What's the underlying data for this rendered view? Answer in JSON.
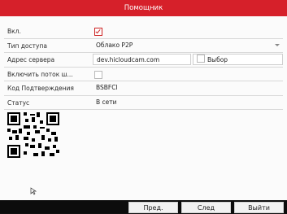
{
  "window": {
    "title": "Помощник"
  },
  "form": {
    "enable_label": "Вкл.",
    "enable_checked": true,
    "access_type_label": "Тип доступа",
    "access_type_value": "Облако P2P",
    "server_label": "Адрес сервера",
    "server_value": "dev.hicloudcam.com",
    "select_label": "Выбор",
    "stream_label": "Включить поток ш...",
    "stream_checked": false,
    "code_label": "Код Подтверждения",
    "code_value": "BSBFCI",
    "status_label": "Статус",
    "status_value": "В сети"
  },
  "buttons": {
    "prev": "Пред.",
    "next": "След",
    "exit": "Выйти"
  },
  "colors": {
    "accent": "#d6202a",
    "bottom_bar": "#0c0c0c"
  }
}
